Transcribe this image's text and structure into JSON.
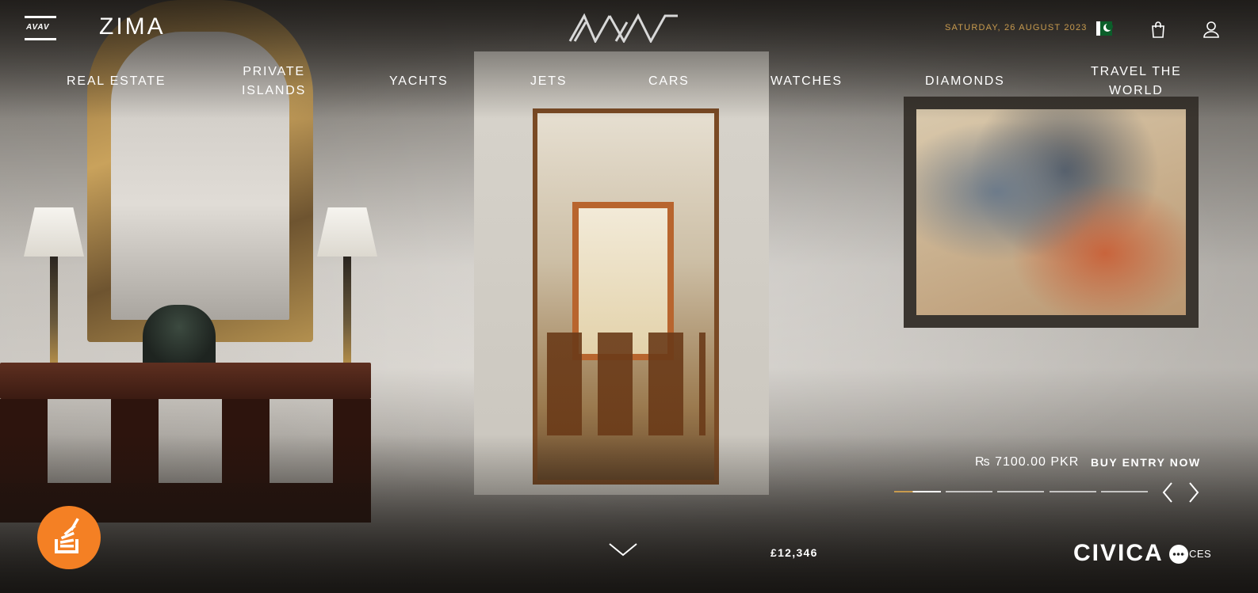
{
  "header": {
    "menu_logo": "AVAV",
    "brand_left": "ZIMA",
    "brand_center": "AVAV",
    "date": "SATURDAY, 26 AUGUST 2023",
    "flag_icon": "pakistan-flag",
    "bag_icon": "shopping-bag-icon",
    "user_icon": "user-icon",
    "accent_color": "#c79a4e"
  },
  "nav": {
    "items": [
      {
        "label": "REAL ESTATE"
      },
      {
        "label": "PRIVATE\nISLANDS"
      },
      {
        "label": "YACHTS"
      },
      {
        "label": "JETS"
      },
      {
        "label": "CARS"
      },
      {
        "label": "WATCHES"
      },
      {
        "label": "DIAMONDS"
      },
      {
        "label": "TRAVEL THE\nWORLD"
      }
    ]
  },
  "offer": {
    "price": "₨ 7100.00 PKR",
    "cta": "BUY ENTRY NOW"
  },
  "slider": {
    "slide_count": 5,
    "active_index": 0,
    "active_progress": 0.4,
    "prev_icon": "chevron-left-icon",
    "next_icon": "chevron-right-icon"
  },
  "footer": {
    "stack_overflow_icon": "stack-overflow-icon",
    "scroll_icon": "chevron-down-icon",
    "pound_value": "£12,346",
    "civica": "CIVICA",
    "ces": "CES",
    "so_color": "#f48024"
  }
}
